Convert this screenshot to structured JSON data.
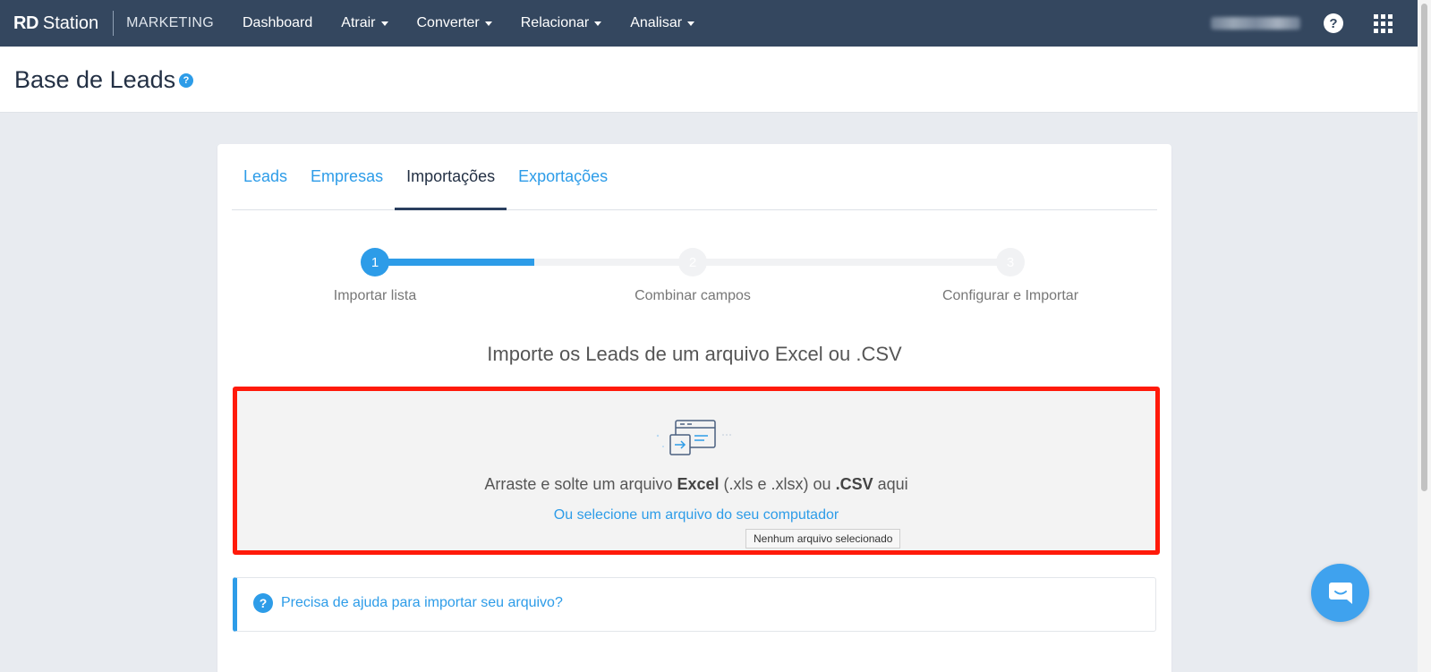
{
  "nav": {
    "brand_rd": "RD",
    "brand_station": "Station",
    "brand_product": "MARKETING",
    "menu": [
      {
        "label": "Dashboard",
        "dropdown": false
      },
      {
        "label": "Atrair",
        "dropdown": true
      },
      {
        "label": "Converter",
        "dropdown": true
      },
      {
        "label": "Relacionar",
        "dropdown": true
      },
      {
        "label": "Analisar",
        "dropdown": true
      }
    ],
    "help_icon": "question-circle-icon",
    "apps_icon": "apps-grid-icon"
  },
  "header": {
    "title": "Base de Leads",
    "help_glyph": "?"
  },
  "tabs": [
    {
      "label": "Leads",
      "active": false
    },
    {
      "label": "Empresas",
      "active": false
    },
    {
      "label": "Importações",
      "active": true
    },
    {
      "label": "Exportações",
      "active": false
    }
  ],
  "stepper": {
    "progress": 0.25,
    "steps": [
      {
        "number": "1",
        "label": "Importar lista",
        "state": "current"
      },
      {
        "number": "2",
        "label": "Combinar campos",
        "state": "pending"
      },
      {
        "number": "3",
        "label": "Configurar e Importar",
        "state": "pending"
      }
    ]
  },
  "import": {
    "title": "Importe os Leads de um arquivo Excel ou .CSV",
    "drop_prefix": "Arraste e solte um arquivo ",
    "drop_excel": "Excel",
    "drop_middle": " (.xls e .xlsx) ou ",
    "drop_csv": ".CSV",
    "drop_suffix": " aqui",
    "select_link": "Ou selecione um arquivo do seu computador",
    "file_tooltip": "Nenhum arquivo selecionado",
    "icon": "file-import-icon"
  },
  "help": {
    "link": "Precisa de ajuda para importar seu arquivo?",
    "glyph": "?"
  },
  "chat": {
    "icon": "chat-bubble-icon"
  },
  "colors": {
    "nav_bg": "#34475f",
    "accent": "#2d9ce8",
    "highlight_border": "#ff1a0a",
    "page_bg": "#e8ebf0"
  }
}
